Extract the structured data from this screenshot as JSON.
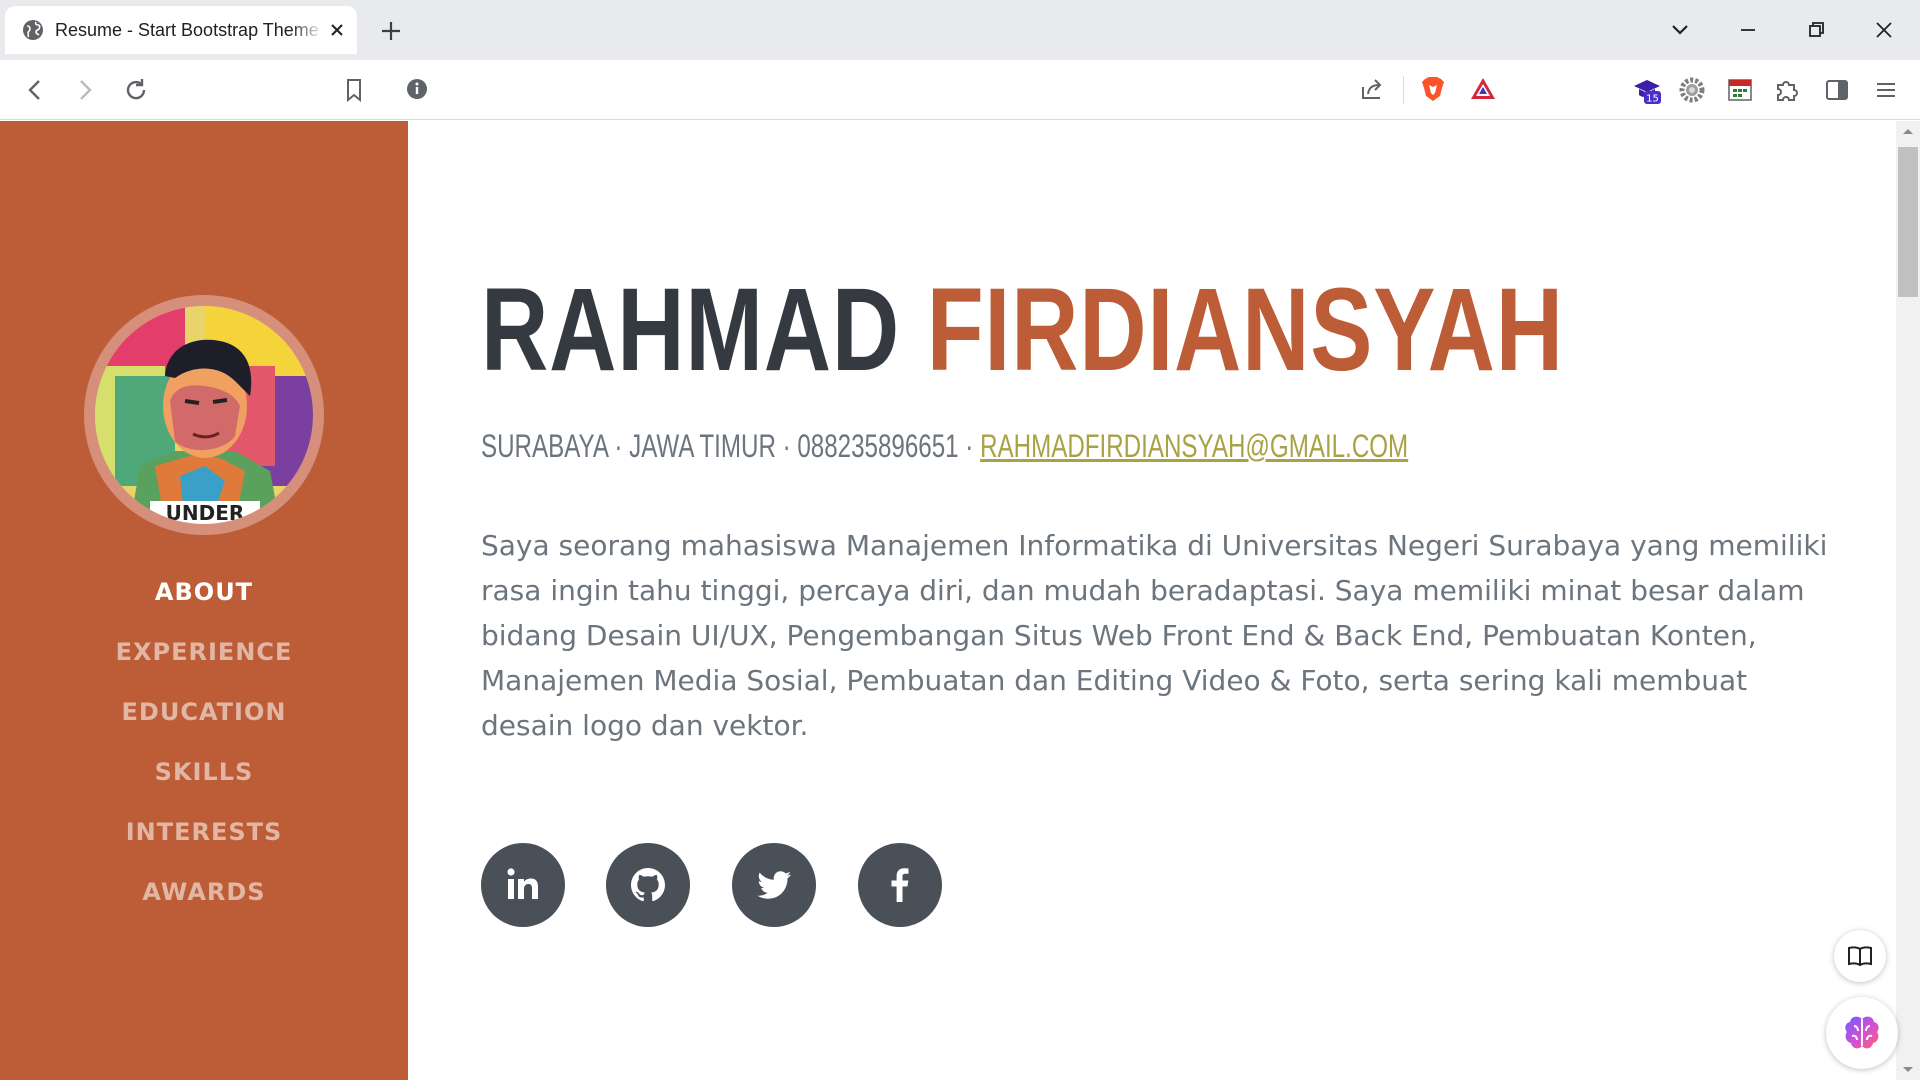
{
  "browser": {
    "tab": {
      "title": "Resume - Start Bootstrap Theme",
      "favicon": "globe-icon"
    },
    "toolbar": {
      "back": "back-arrow-icon",
      "forward": "forward-arrow-icon",
      "reload": "reload-icon",
      "bookmark": "bookmark-icon",
      "site_info": "info-icon",
      "share": "share-icon",
      "brave_shields": "brave-lion-icon",
      "brave_rewards": "triangle-rewards-icon",
      "extensions": [
        "graduation-cap-icon",
        "gear-extension-icon",
        "calendar-extension-icon",
        "puzzle-icon",
        "sidebar-icon",
        "menu-icon"
      ],
      "extension_badge": "15"
    }
  },
  "page": {
    "name": {
      "first": "RAHMAD",
      "last": "FIRDIANSYAH"
    },
    "subheading": {
      "location": "SURABAYA · JAWA TIMUR · 088235896651 · ",
      "email": "RAHMADFIRDIANSYAH@GMAIL.COM"
    },
    "about": "Saya seorang mahasiswa Manajemen Informatika di Universitas Negeri Surabaya yang memiliki rasa ingin tahu tinggi, percaya diri, dan mudah beradaptasi. Saya memiliki minat besar dalam bidang Desain UI/UX, Pengembangan Situs Web Front End & Back End, Pembuatan Konten, Manajemen Media Sosial, Pembuatan dan Editing Video & Foto, serta sering kali membuat desain logo dan vektor.",
    "nav": [
      "ABOUT",
      "EXPERIENCE",
      "EDUCATION",
      "SKILLS",
      "INTERESTS",
      "AWARDS"
    ],
    "active_nav": "ABOUT",
    "social": [
      "linkedin-icon",
      "github-icon",
      "twitter-icon",
      "facebook-icon"
    ],
    "profile_shirt_text": "UNDER",
    "colors": {
      "primary": "#bd5d38",
      "dark": "#343a40",
      "muted": "#6c757d",
      "link": "#a8a246"
    }
  }
}
